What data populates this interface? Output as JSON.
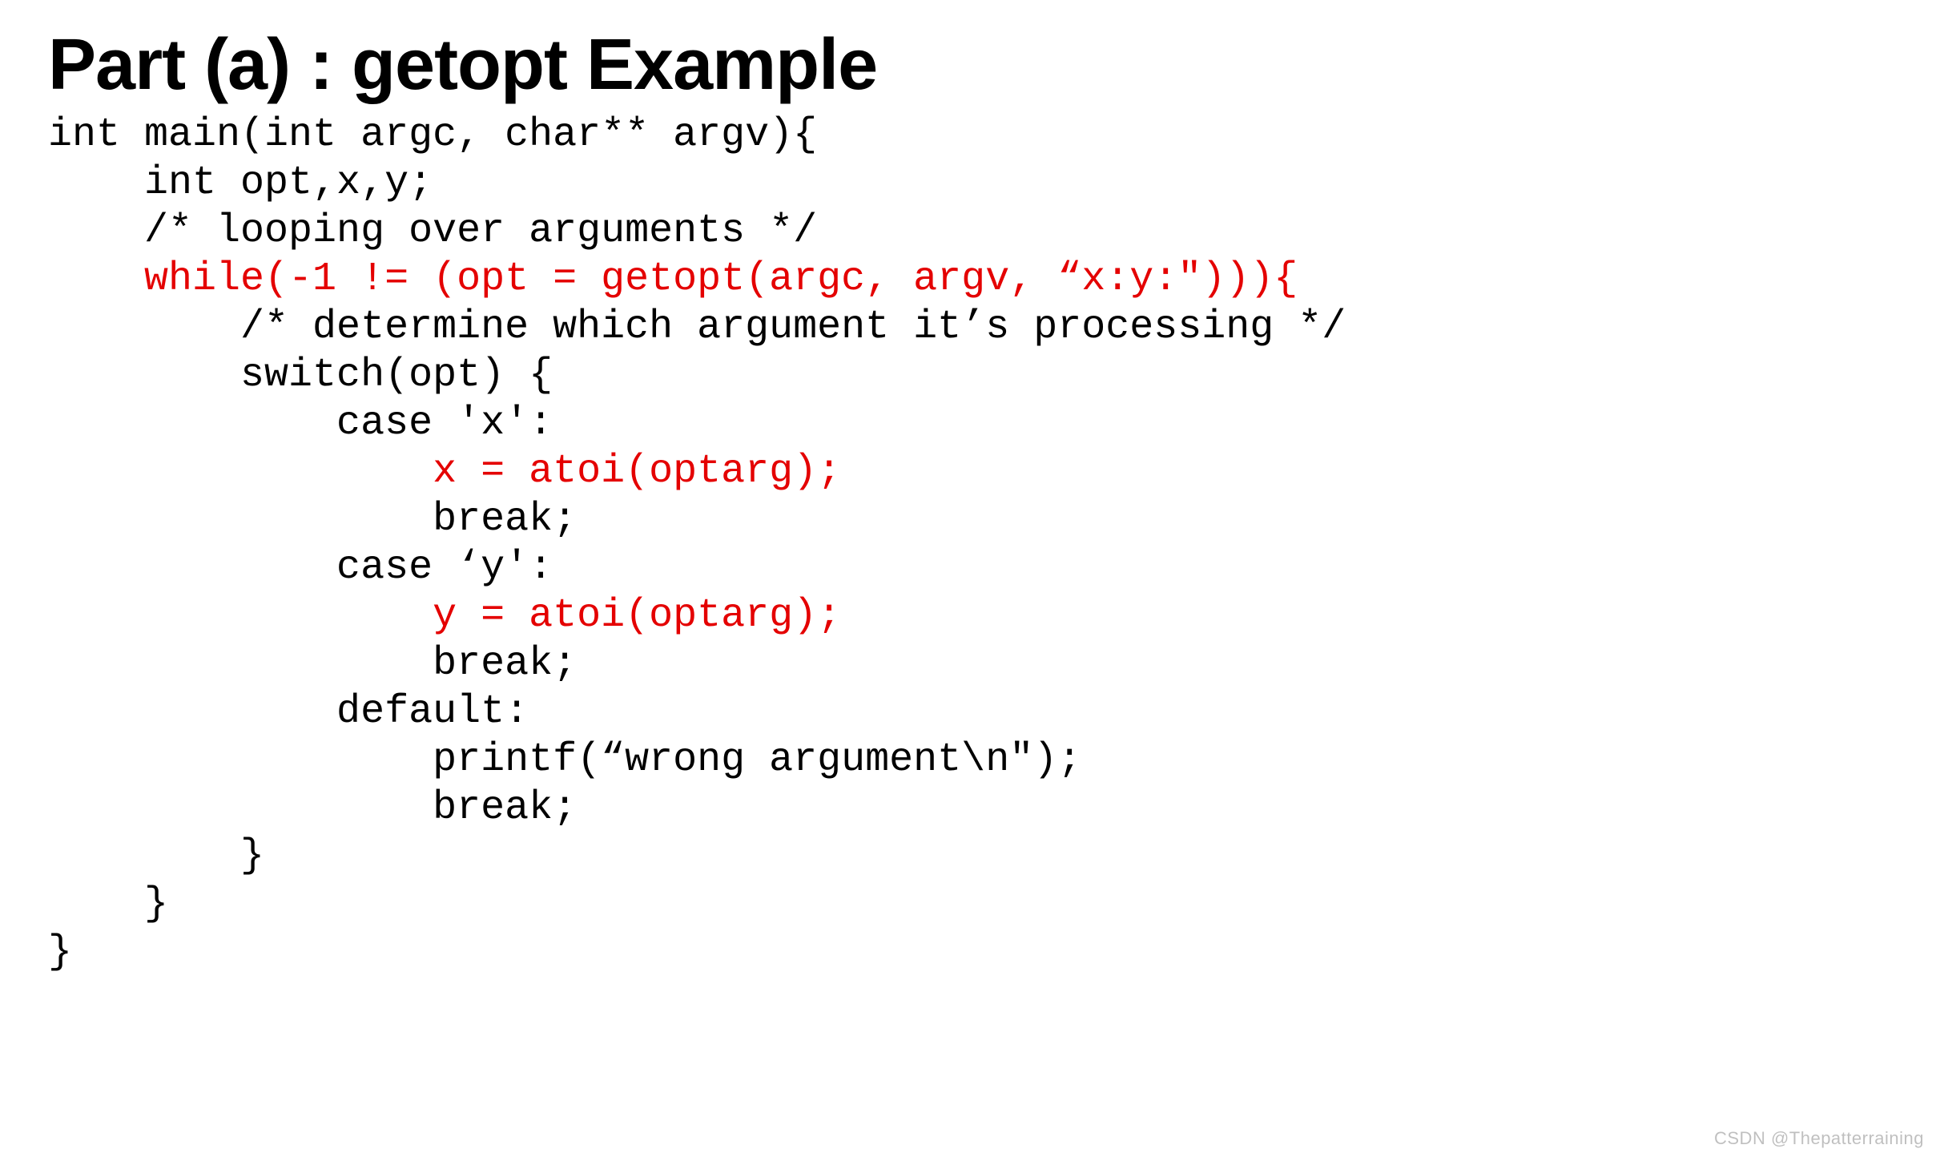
{
  "title": "Part (a) : getopt Example",
  "code": {
    "l01": "int main(int argc, char** argv){",
    "l02": "    int opt,x,y;",
    "l03": "    /* looping over arguments */",
    "l04": "    while(-1 != (opt = getopt(argc, argv, “x:y:\"))){",
    "l05": "        /* determine which argument it’s processing */",
    "l06": "        switch(opt) {",
    "l07": "            case 'x':",
    "l08": "                x = atoi(optarg);",
    "l09": "                break;",
    "l10": "            case ‘y':",
    "l11": "                y = atoi(optarg);",
    "l12": "                break;",
    "l13": "            default:",
    "l14": "                printf(“wrong argument\\n\");",
    "l15": "                break;",
    "l16": "        }",
    "l17": "    }",
    "l18": "}"
  },
  "watermark": "CSDN @Thepatterraining"
}
